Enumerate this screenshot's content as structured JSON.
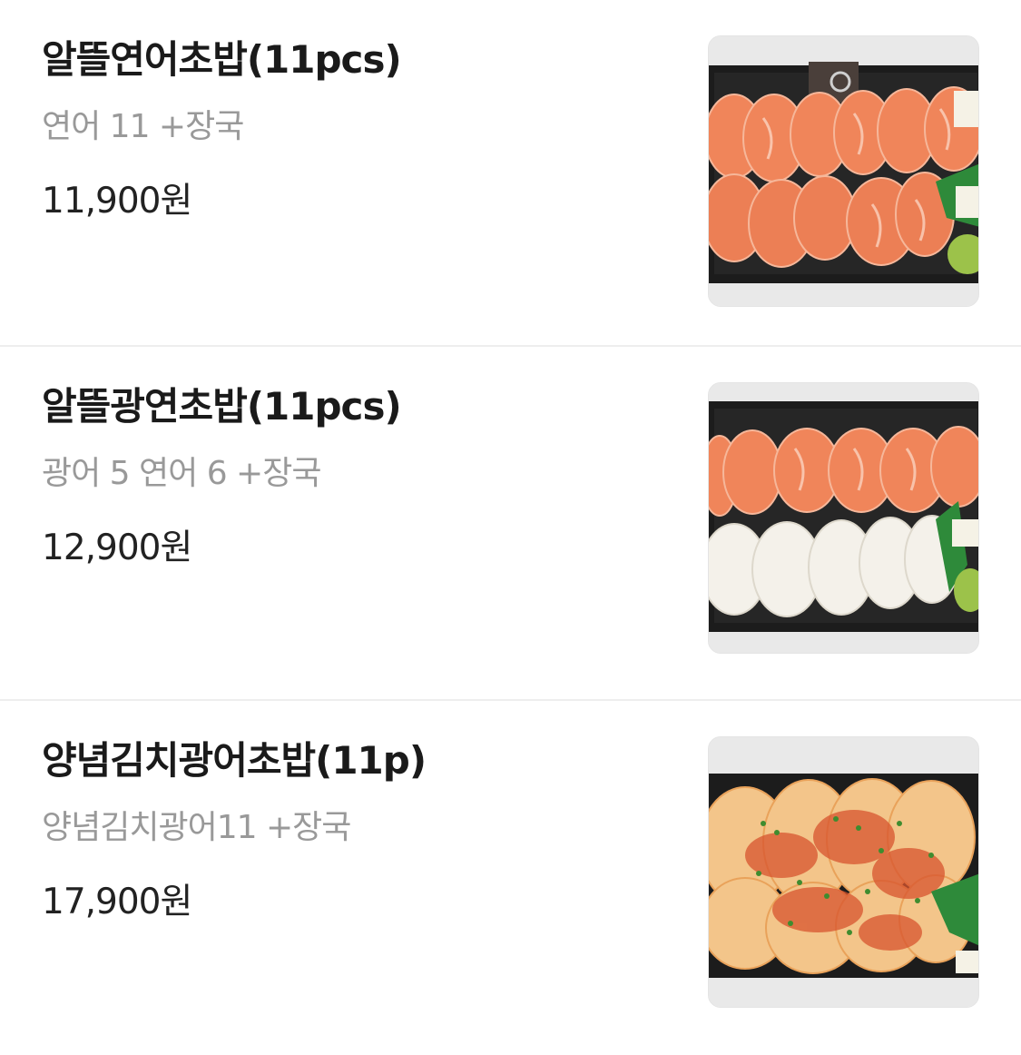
{
  "menu": {
    "items": [
      {
        "name": "알뜰연어초밥(11pcs)",
        "description": "연어 11 +장국",
        "price": "11,900원",
        "photo_icon": "salmon-sushi-photo"
      },
      {
        "name": "알뜰광연초밥(11pcs)",
        "description": "광어 5 연어 6 +장국",
        "price": "12,900원",
        "photo_icon": "flatfish-salmon-sushi-photo"
      },
      {
        "name": "양념김치광어초밥(11p)",
        "description": "양념김치광어11 +장국",
        "price": "17,900원",
        "photo_icon": "kimchi-flatfish-sushi-photo"
      }
    ]
  },
  "colors": {
    "title": "#1a1a1a",
    "description": "#999999",
    "price": "#222222",
    "divider": "#eeeeee",
    "salmon": "#f08a5d",
    "flatfish": "#f4f1ea",
    "tray": "#1c1c1c"
  }
}
